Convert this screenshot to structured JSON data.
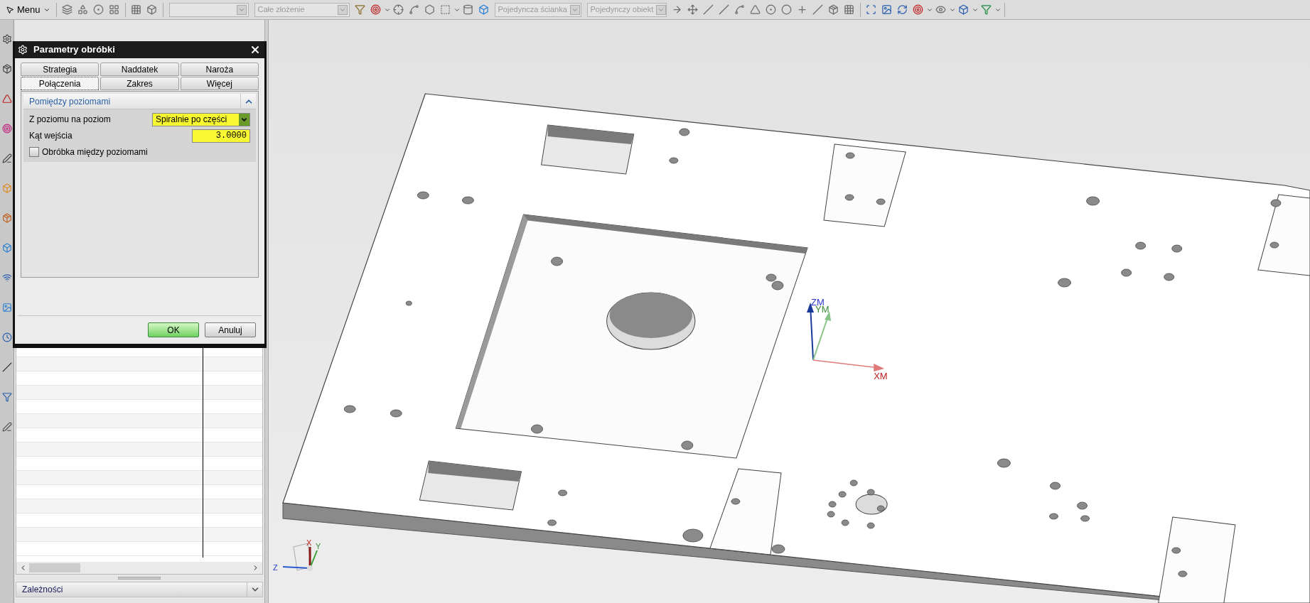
{
  "toolbar": {
    "menu": "Menu",
    "dropdowns": [
      {
        "disabled": true
      },
      {
        "value": "Całe złożenie",
        "disabled": true
      },
      {
        "value": "Pojedyncza ścianka",
        "disabled": true
      },
      {
        "value": "Pojedynczy obiekt",
        "disabled": true
      }
    ]
  },
  "dialog": {
    "title": "Parametry obróbki",
    "tab_rows": [
      [
        {
          "label": "Strategia",
          "selected": false
        },
        {
          "label": "Naddatek",
          "selected": false
        },
        {
          "label": "Naroża",
          "selected": false
        }
      ],
      [
        {
          "label": "Połączenia",
          "selected": true
        },
        {
          "label": "Zakres",
          "selected": false
        },
        {
          "label": "Więcej",
          "selected": false
        }
      ]
    ],
    "section": {
      "title": "Pomiędzy poziomami",
      "expanded": true,
      "fields": [
        {
          "kind": "dropdown",
          "label": "Z poziomu na poziom",
          "value": "Spiralnie po części"
        },
        {
          "kind": "number",
          "label": "Kąt wejścia",
          "value": "3.0000"
        },
        {
          "kind": "checkbox",
          "label": "Obróbka między poziomami",
          "checked": false
        }
      ]
    },
    "buttons": [
      {
        "label": "OK",
        "primary": true
      },
      {
        "label": "Anuluj",
        "primary": false
      }
    ]
  },
  "navigator": {
    "panel": {
      "title": "Zależności",
      "expanded": false
    }
  },
  "viewport": {
    "work_axes": [
      "ZM",
      "YM",
      "XM"
    ],
    "view_axes": [
      "X",
      "Y",
      "Z"
    ]
  }
}
